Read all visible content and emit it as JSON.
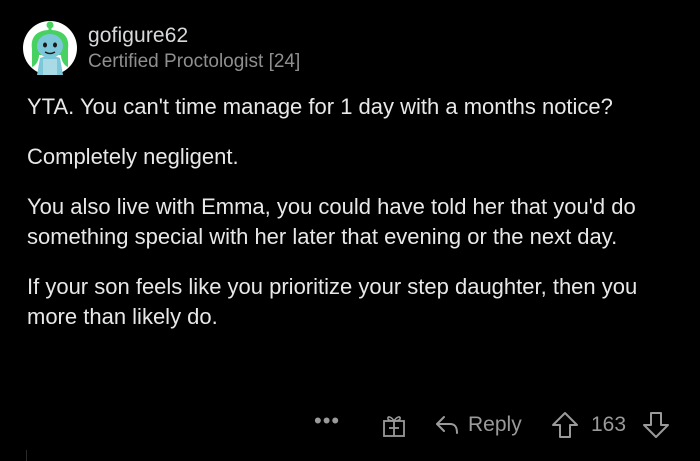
{
  "comment": {
    "username": "gofigure62",
    "flair": "Certified Proctologist [24]",
    "paragraphs": [
      "YTA. You can't time manage for 1 day with a months notice?",
      "Completely negligent.",
      "You also live with Emma, you could have told her that you'd do something special with her later that evening or the next day.",
      "If your son feels like you prioritize your step daughter, then you more than likely do."
    ],
    "actions": {
      "more": "•••",
      "reply_label": "Reply",
      "score": "163"
    }
  },
  "icons": {
    "avatar": "snoo-avatar-icon",
    "more": "more-options-icon",
    "award": "gift-icon",
    "reply": "reply-arrow-icon",
    "upvote": "upvote-arrow-icon",
    "downvote": "downvote-arrow-icon"
  },
  "colors": {
    "background": "#000000",
    "avatar_green": "#46d160",
    "avatar_skin": "#7cc8d9",
    "text_primary": "#e8e8e8",
    "text_muted": "#8f8f8f"
  }
}
